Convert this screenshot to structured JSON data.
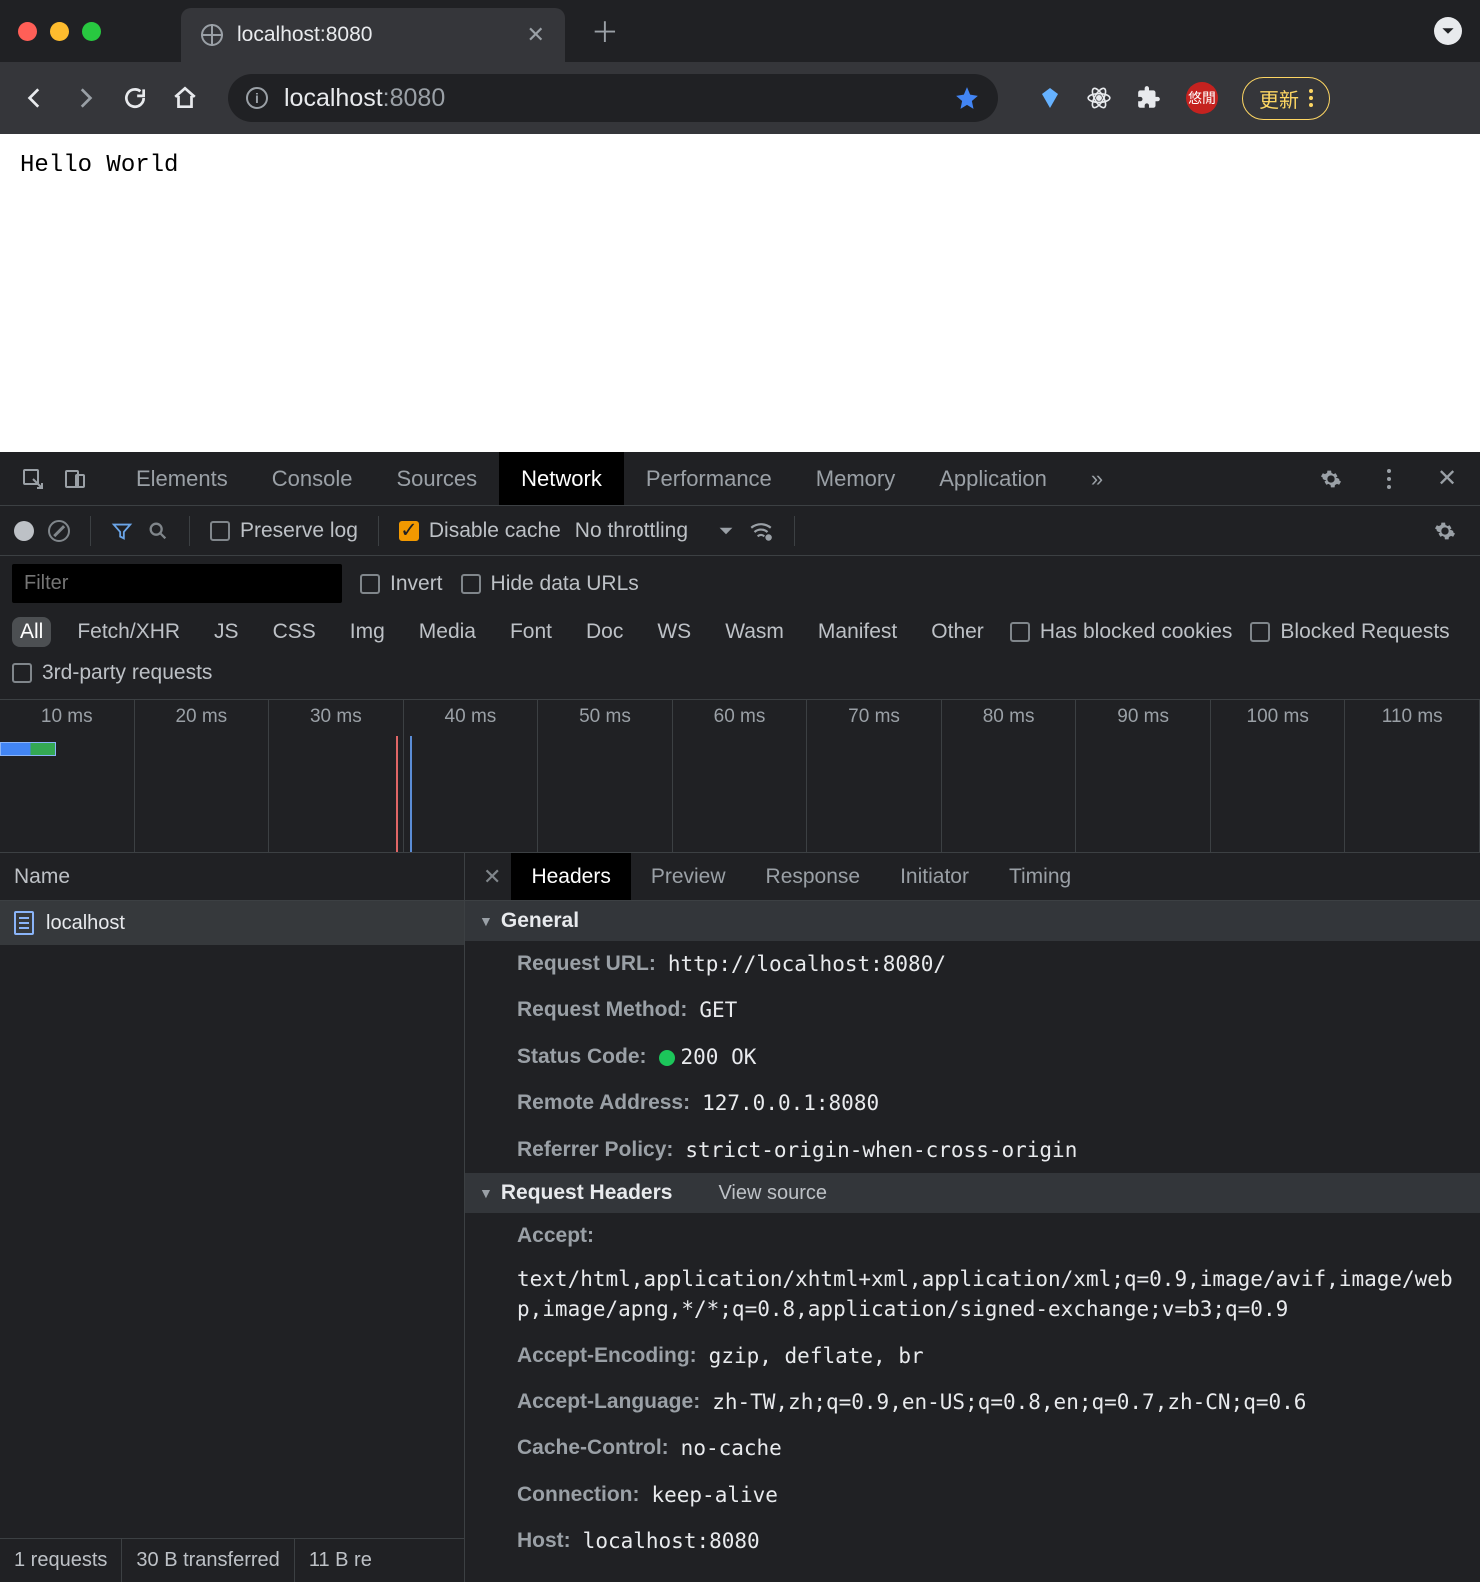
{
  "browser": {
    "tab_title": "localhost:8080",
    "url_main": "localhost",
    "url_path": ":8080",
    "update_label": "更新",
    "ext_badge": "悠閒"
  },
  "page": {
    "body_text": "Hello World"
  },
  "devtools": {
    "tabs": [
      "Elements",
      "Console",
      "Sources",
      "Network",
      "Performance",
      "Memory",
      "Application"
    ],
    "active_tab": "Network",
    "preserve_log": "Preserve log",
    "disable_cache": "Disable cache",
    "throttling": "No throttling",
    "filter_placeholder": "Filter",
    "invert": "Invert",
    "hide_data_urls": "Hide data URLs",
    "types": [
      "All",
      "Fetch/XHR",
      "JS",
      "CSS",
      "Img",
      "Media",
      "Font",
      "Doc",
      "WS",
      "Wasm",
      "Manifest",
      "Other"
    ],
    "has_blocked_cookies": "Has blocked cookies",
    "blocked_requests": "Blocked Requests",
    "third_party": "3rd-party requests",
    "timeline_ticks": [
      "10 ms",
      "20 ms",
      "30 ms",
      "40 ms",
      "50 ms",
      "60 ms",
      "70 ms",
      "80 ms",
      "90 ms",
      "100 ms",
      "110 ms"
    ],
    "reqlist_header": "Name",
    "request_name": "localhost",
    "status": {
      "requests": "1 requests",
      "transferred": "30 B transferred",
      "resources": "11 B re"
    },
    "detail_tabs": [
      "Headers",
      "Preview",
      "Response",
      "Initiator",
      "Timing"
    ],
    "sections": {
      "general": "General",
      "request_headers": "Request Headers",
      "view_source": "View source"
    },
    "general": {
      "request_url_k": "Request URL:",
      "request_url_v": "http://localhost:8080/",
      "request_method_k": "Request Method:",
      "request_method_v": "GET",
      "status_code_k": "Status Code:",
      "status_code_v": "200 OK",
      "remote_addr_k": "Remote Address:",
      "remote_addr_v": "127.0.0.1:8080",
      "referrer_policy_k": "Referrer Policy:",
      "referrer_policy_v": "strict-origin-when-cross-origin"
    },
    "req_headers": {
      "accept_k": "Accept:",
      "accept_v": "text/html,application/xhtml+xml,application/xml;q=0.9,image/avif,image/webp,image/apng,*/*;q=0.8,application/signed-exchange;v=b3;q=0.9",
      "accept_encoding_k": "Accept-Encoding:",
      "accept_encoding_v": "gzip, deflate, br",
      "accept_language_k": "Accept-Language:",
      "accept_language_v": "zh-TW,zh;q=0.9,en-US;q=0.8,en;q=0.7,zh-CN;q=0.6",
      "cache_control_k": "Cache-Control:",
      "cache_control_v": "no-cache",
      "connection_k": "Connection:",
      "connection_v": "keep-alive",
      "host_k": "Host:",
      "host_v": "localhost:8080"
    }
  }
}
